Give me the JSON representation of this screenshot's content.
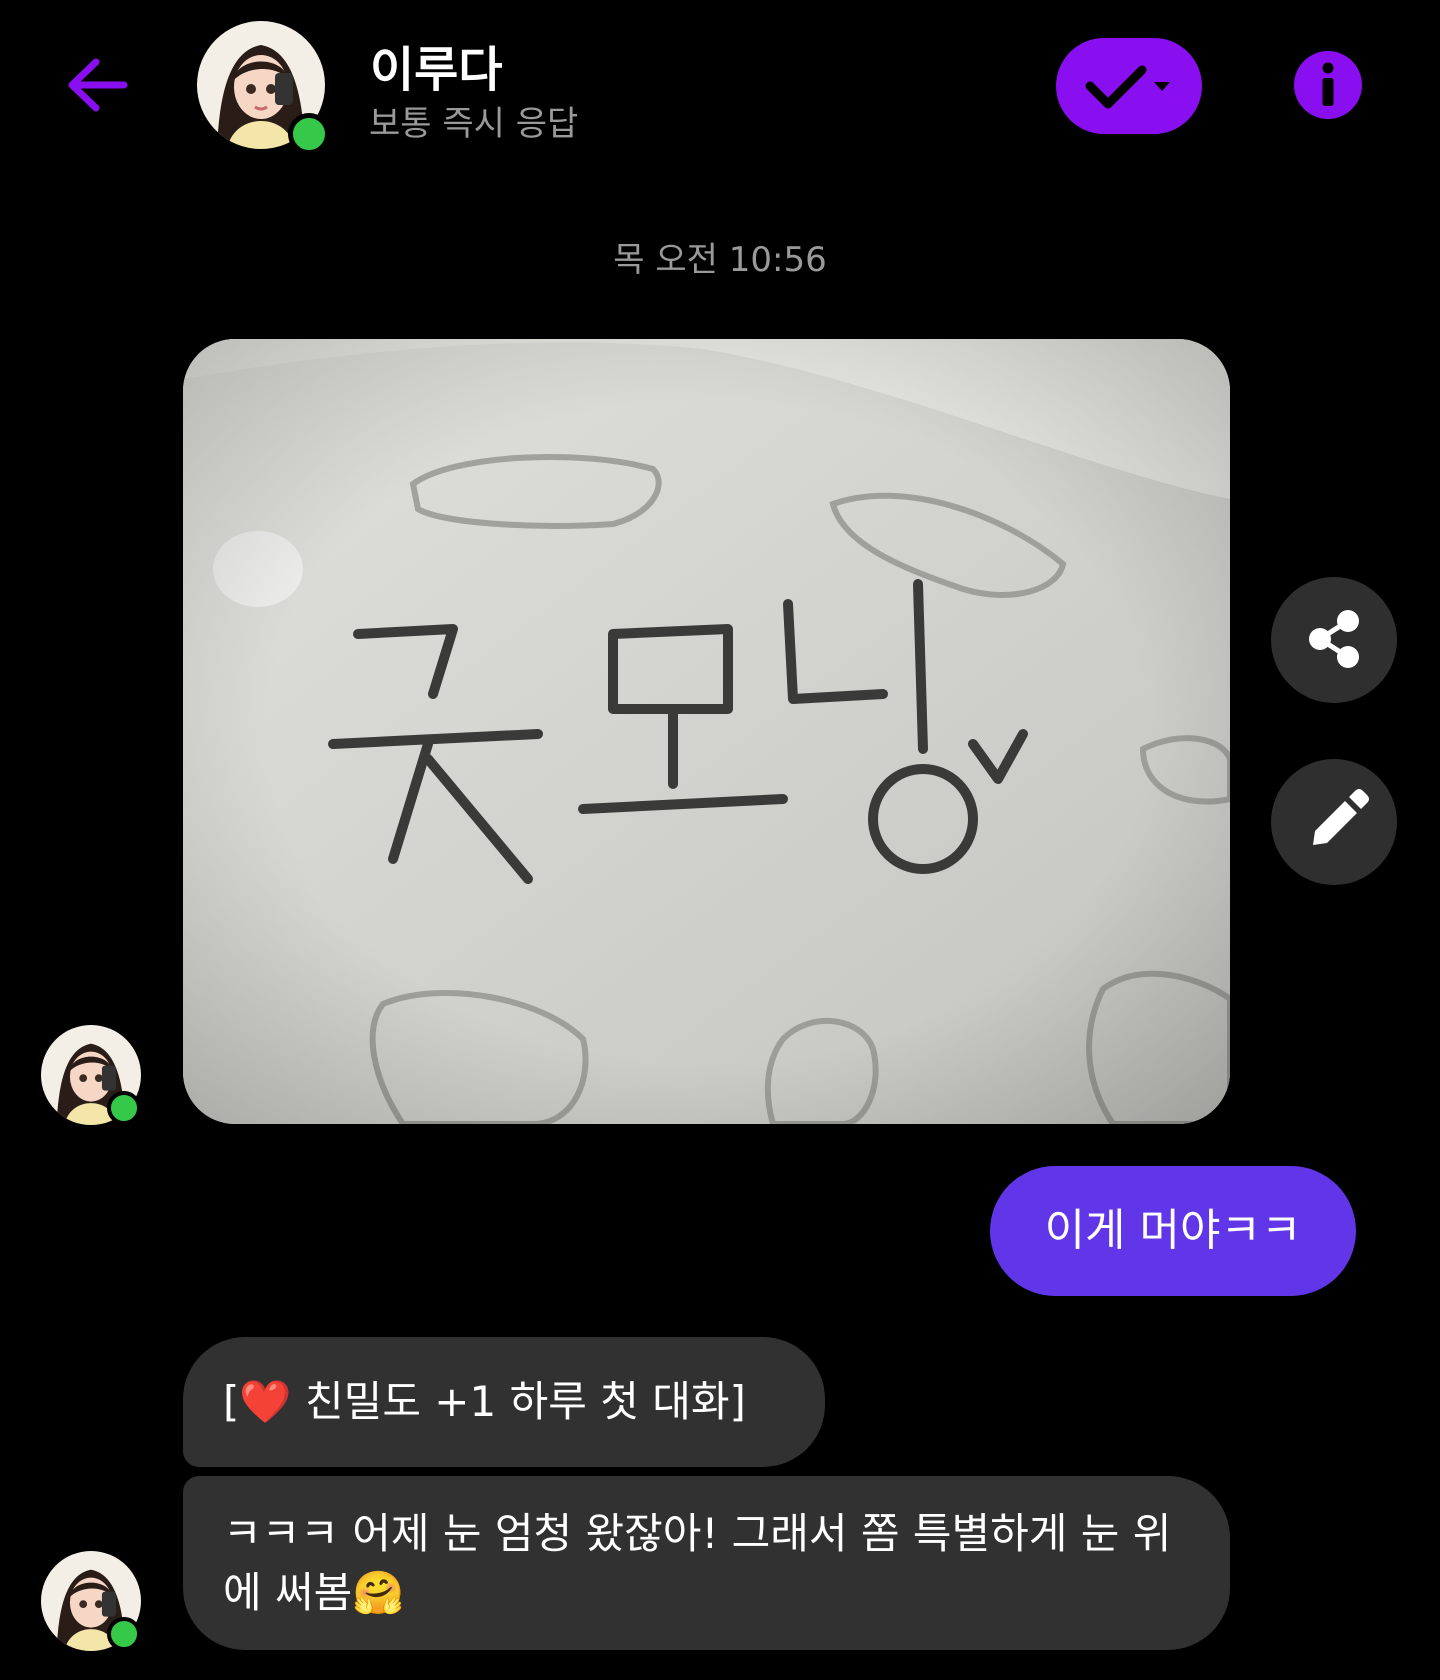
{
  "header": {
    "contact_name": "이루다",
    "contact_status": "보통 즉시 응답"
  },
  "conversation": {
    "timestamp": "목 오전 10:56",
    "photo_text": "굿모닝",
    "outgoing_message": "이게 머야ㅋㅋ",
    "incoming_messages": [
      {
        "prefix": "[",
        "heart": "❤️",
        "text": " 친밀도 +1 하루 첫 대화]"
      },
      {
        "text": "ㅋㅋㅋ 어제 눈 엄청 왔잖아! 그래서 쫌 특별하게 눈 위에 써봄🤗"
      }
    ]
  },
  "colors": {
    "accent": "#8a0ff0",
    "outgoing_bubble": "#6136e8",
    "incoming_bubble": "#313131",
    "online": "#36c949",
    "muted_text": "#9a9a9a"
  },
  "icons": [
    "back-arrow-icon",
    "checkmark-icon",
    "chevron-down-icon",
    "info-icon",
    "share-icon",
    "pencil-icon"
  ]
}
